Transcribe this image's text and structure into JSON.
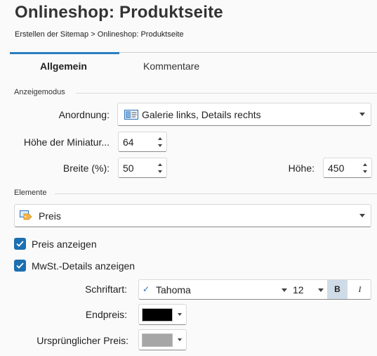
{
  "header": {
    "title": "Onlineshop: Produktseite",
    "breadcrumb": "Erstellen der Sitemap > Onlineshop: Produktseite"
  },
  "tabs": [
    {
      "label": "Allgemein",
      "active": true
    },
    {
      "label": "Kommentare",
      "active": false
    }
  ],
  "display_mode": {
    "section_label": "Anzeigemodus",
    "arrangement_label": "Anordnung:",
    "arrangement_value": "Galerie links, Details rechts",
    "thumb_height_label": "Höhe der Miniatur...",
    "thumb_height_value": "64",
    "width_label": "Breite (%):",
    "width_value": "50",
    "height_label": "Höhe:",
    "height_value": "450"
  },
  "elements": {
    "section_label": "Elemente",
    "selected_element": "Preis",
    "show_price_label": "Preis anzeigen",
    "show_price_checked": true,
    "show_vat_label": "MwSt.-Details anzeigen",
    "show_vat_checked": true,
    "font_label": "Schriftart:",
    "font_name": "Tahoma",
    "font_size": "12",
    "bold_label": "B",
    "italic_label": "I",
    "final_price_label": "Endpreis:",
    "final_price_color": "#000000",
    "original_price_label": "Ursprünglicher Preis:",
    "original_price_color": "#a6a6a6"
  },
  "colors": {
    "accent": "#2a7fc0",
    "checkbox": "#1c6fb0"
  }
}
